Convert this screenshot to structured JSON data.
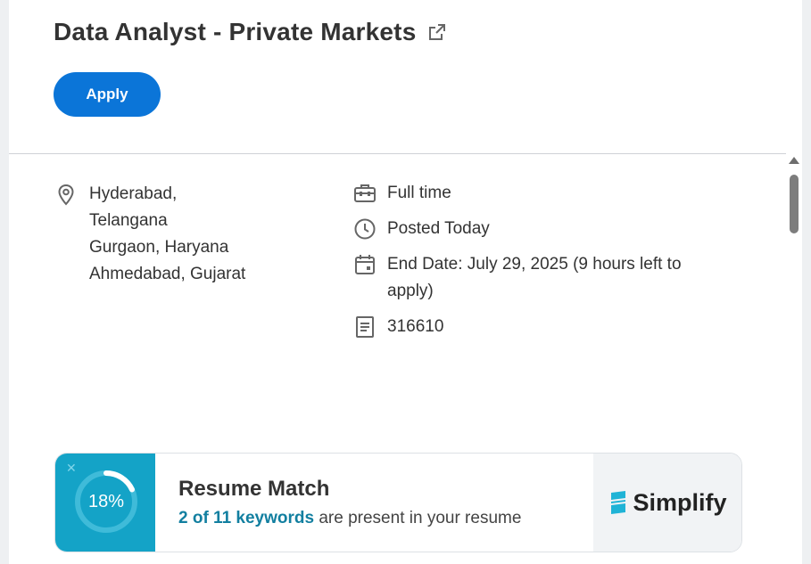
{
  "job": {
    "title": "Data Analyst - Private Markets",
    "apply_label": "Apply"
  },
  "locations": [
    "Hyderabad,",
    "Telangana",
    "Gurgaon, Haryana",
    "Ahmedabad, Gujarat"
  ],
  "meta": {
    "job_type": "Full time",
    "posted": "Posted Today",
    "end_date": "End Date: July 29, 2025 (9 hours left to apply)",
    "job_id": "316610"
  },
  "resume_match": {
    "percent_label": "18%",
    "percent_value": 0.18,
    "title": "Resume Match",
    "keywords_highlight": "2 of 11 keywords",
    "keywords_rest": " are present in your resume",
    "brand": "Simplify"
  },
  "colors": {
    "primary": "#0b75d8",
    "match_bg": "#14a3c7",
    "highlight": "#127fa0"
  }
}
